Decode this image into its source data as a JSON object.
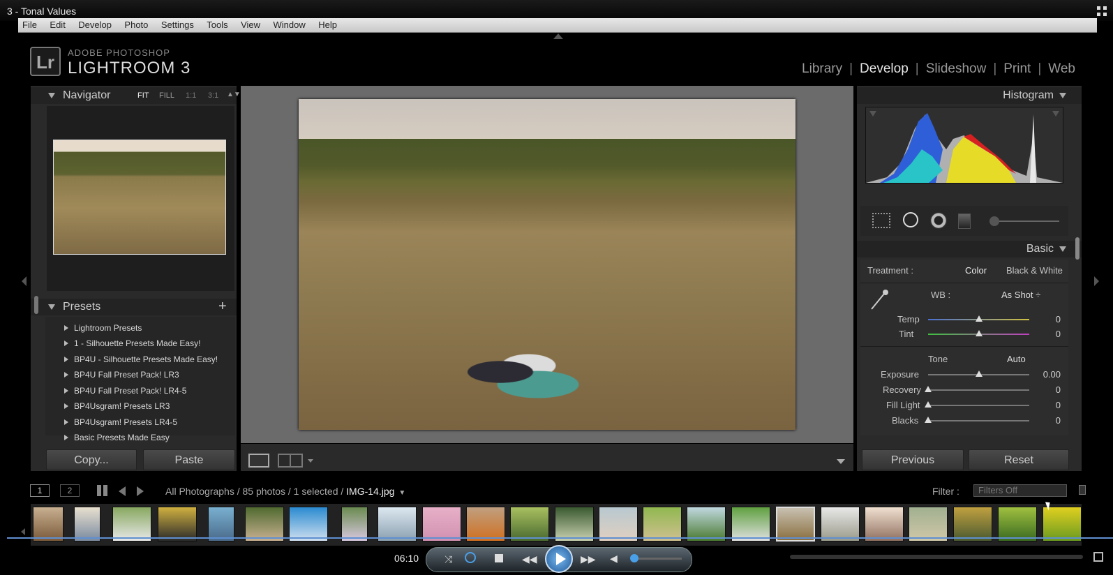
{
  "window": {
    "title": "3 - Tonal Values"
  },
  "menu": [
    "File",
    "Edit",
    "Develop",
    "Photo",
    "Settings",
    "Tools",
    "View",
    "Window",
    "Help"
  ],
  "brand": {
    "logo": "Lr",
    "small": "ADOBE PHOTOSHOP",
    "big": "LIGHTROOM 3"
  },
  "modules": [
    {
      "label": "Library",
      "active": false
    },
    {
      "label": "Develop",
      "active": true
    },
    {
      "label": "Slideshow",
      "active": false
    },
    {
      "label": "Print",
      "active": false
    },
    {
      "label": "Web",
      "active": false
    }
  ],
  "navigator": {
    "title": "Navigator",
    "zoom": [
      "FIT",
      "FILL",
      "1:1",
      "3:1"
    ]
  },
  "presets": {
    "title": "Presets",
    "add": "+",
    "items": [
      "Lightroom Presets",
      "1 - Silhouette Presets Made Easy!",
      "BP4U - Silhouette Presets Made Easy!",
      "BP4U Fall Preset Pack! LR3",
      "BP4U Fall Preset Pack! LR4-5",
      "BP4Usgram! Presets LR3",
      "BP4Usgram! Presets LR4-5",
      "Basic Presets Made Easy"
    ]
  },
  "left_buttons": {
    "copy": "Copy...",
    "paste": "Paste"
  },
  "histogram": {
    "title": "Histogram"
  },
  "basic": {
    "title": "Basic",
    "treatment_label": "Treatment :",
    "treatment_color": "Color",
    "treatment_bw": "Black & White",
    "wb_label": "WB :",
    "wb_value": "As Shot ÷",
    "tone_label": "Tone",
    "auto": "Auto",
    "sliders": [
      {
        "label": "Temp",
        "value": "0",
        "pos": 0.5
      },
      {
        "label": "Tint",
        "value": "0",
        "pos": 0.5
      },
      {
        "label": "Exposure",
        "value": "0.00",
        "pos": 0.5
      },
      {
        "label": "Recovery",
        "value": "0",
        "pos": 0
      },
      {
        "label": "Fill Light",
        "value": "0",
        "pos": 0
      },
      {
        "label": "Blacks",
        "value": "0",
        "pos": 0
      }
    ]
  },
  "right_buttons": {
    "previous": "Previous",
    "reset": "Reset"
  },
  "filmstrip": {
    "page1": "1",
    "page2": "2",
    "path": "All Photographs / 85 photos / 1 selected / ",
    "file": "IMG-14.jpg",
    "filter_label": "Filter :",
    "filter_value": "Filters Off"
  },
  "player": {
    "time": "06:10",
    "progress": 0.12
  },
  "colors": {
    "panel": "#2a2a2a",
    "center": "#6b6b6b",
    "accent": "#5f8fd0"
  }
}
